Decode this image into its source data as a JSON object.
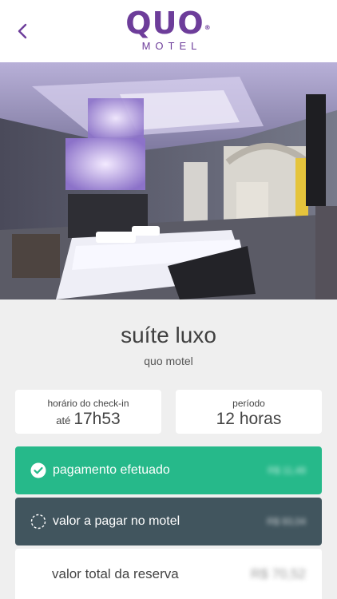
{
  "header": {
    "back_icon": "chevron-left-icon",
    "logo_main": "QUO",
    "logo_reg": "®",
    "logo_sub": "MOTEL"
  },
  "room": {
    "name": "suíte luxo",
    "motel": "quo motel"
  },
  "checkin": {
    "label": "horário do check-in",
    "prefix": "até",
    "time": "17h53"
  },
  "periodo": {
    "label": "período",
    "value": "12 horas"
  },
  "payment": {
    "paid_label": "pagamento efetuado",
    "paid_amount": "R$ 11,48",
    "due_label": "valor a pagar no motel",
    "due_amount": "R$ 93,04",
    "total_label": "valor total da reserva",
    "total_amount": "R$ 70,52"
  },
  "colors": {
    "brand": "#6d3d9a",
    "paid": "#26b98a",
    "due": "#41555e"
  }
}
